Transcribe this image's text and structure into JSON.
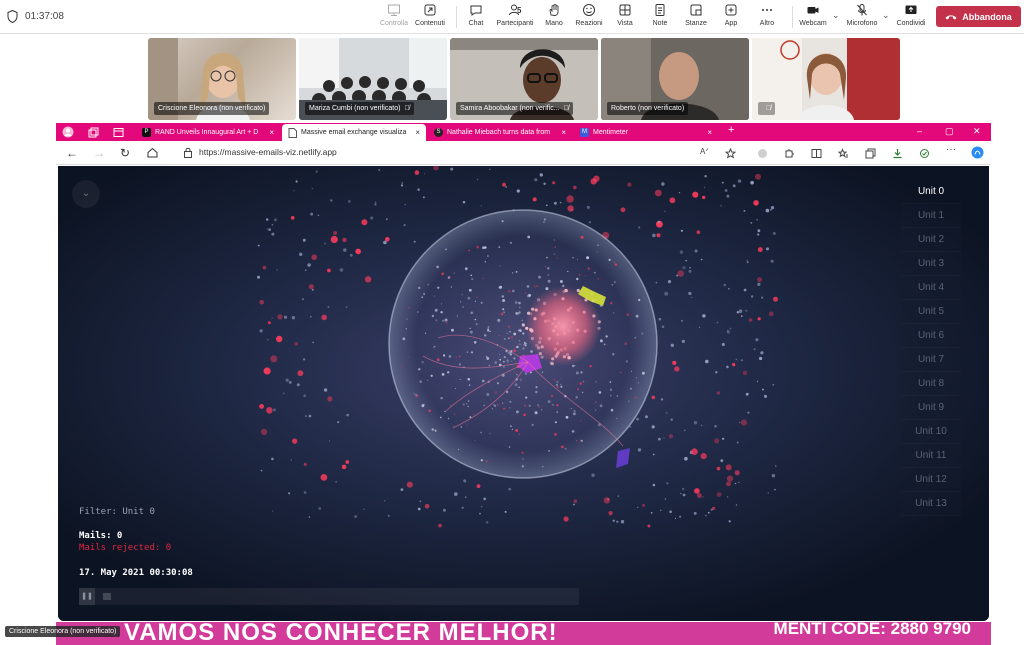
{
  "meeting": {
    "timer": "01:37:08",
    "toolbar": [
      {
        "label": "Controlla",
        "icon": "share-control-icon",
        "disabled": true
      },
      {
        "label": "Contenuti",
        "icon": "share-content-icon"
      },
      {
        "label": "Chat",
        "icon": "chat-icon"
      },
      {
        "label": "Partecipanti",
        "icon": "people-icon",
        "count": "5"
      },
      {
        "label": "Mano",
        "icon": "raise-hand-icon"
      },
      {
        "label": "Reazioni",
        "icon": "smiley-icon"
      },
      {
        "label": "Vista",
        "icon": "grid-view-icon"
      },
      {
        "label": "Note",
        "icon": "notes-icon"
      },
      {
        "label": "Stanze",
        "icon": "breakout-rooms-icon"
      },
      {
        "label": "App",
        "icon": "add-app-icon"
      },
      {
        "label": "Altro",
        "icon": "more-icon"
      },
      {
        "label": "Webcam",
        "icon": "camera-icon"
      },
      {
        "label": "Microfono",
        "icon": "mic-off-icon"
      },
      {
        "label": "Condividi",
        "icon": "share-icon"
      }
    ],
    "leave_label": "Abbandona",
    "participants": [
      {
        "name": "Criscione Eleonora (non verificato)",
        "muted": false
      },
      {
        "name": "Mariza Cumbi (non verificato)",
        "muted": true
      },
      {
        "name": "Samira Aboobakar (non verific...",
        "muted": true
      },
      {
        "name": "Roberto (non verificato)",
        "muted": false
      },
      {
        "name": "",
        "muted": true
      }
    ],
    "self_label": "Criscione Eleonora (non verificato)"
  },
  "browser": {
    "tabs": [
      {
        "title": "RAND Unveils Innaugural Art + D",
        "favicon": "P"
      },
      {
        "title": "Massive email exchange visualiza",
        "favicon": "page"
      },
      {
        "title": "Nathalie Miebach turns data from",
        "favicon": "S"
      },
      {
        "title": "Mentimeter",
        "favicon": "M"
      }
    ],
    "new_tab": "+",
    "url": "https://massive-emails-viz.netlify.app"
  },
  "viz": {
    "units": [
      "Unit 0",
      "Unit 1",
      "Unit 2",
      "Unit 3",
      "Unit 4",
      "Unit 5",
      "Unit 6",
      "Unit 7",
      "Unit 8",
      "Unit 9",
      "Unit 10",
      "Unit 11",
      "Unit 12",
      "Unit 13"
    ],
    "selected_unit": "Unit 0",
    "filter": "Filter: Unit 0",
    "mails": "Mails: 0",
    "mails_rejected": "Mails rejected: 0",
    "datetime": "17. May 2021 00:30:08",
    "colors": {
      "mail": "#ff3b5c",
      "rejected": "#e0253f",
      "neutral": "#9aa6c8"
    }
  },
  "banner": {
    "text": "VAMOS NOS CONHECER MELHOR!",
    "code": "MENTI CODE: 2880 9790",
    "subtext": ""
  }
}
